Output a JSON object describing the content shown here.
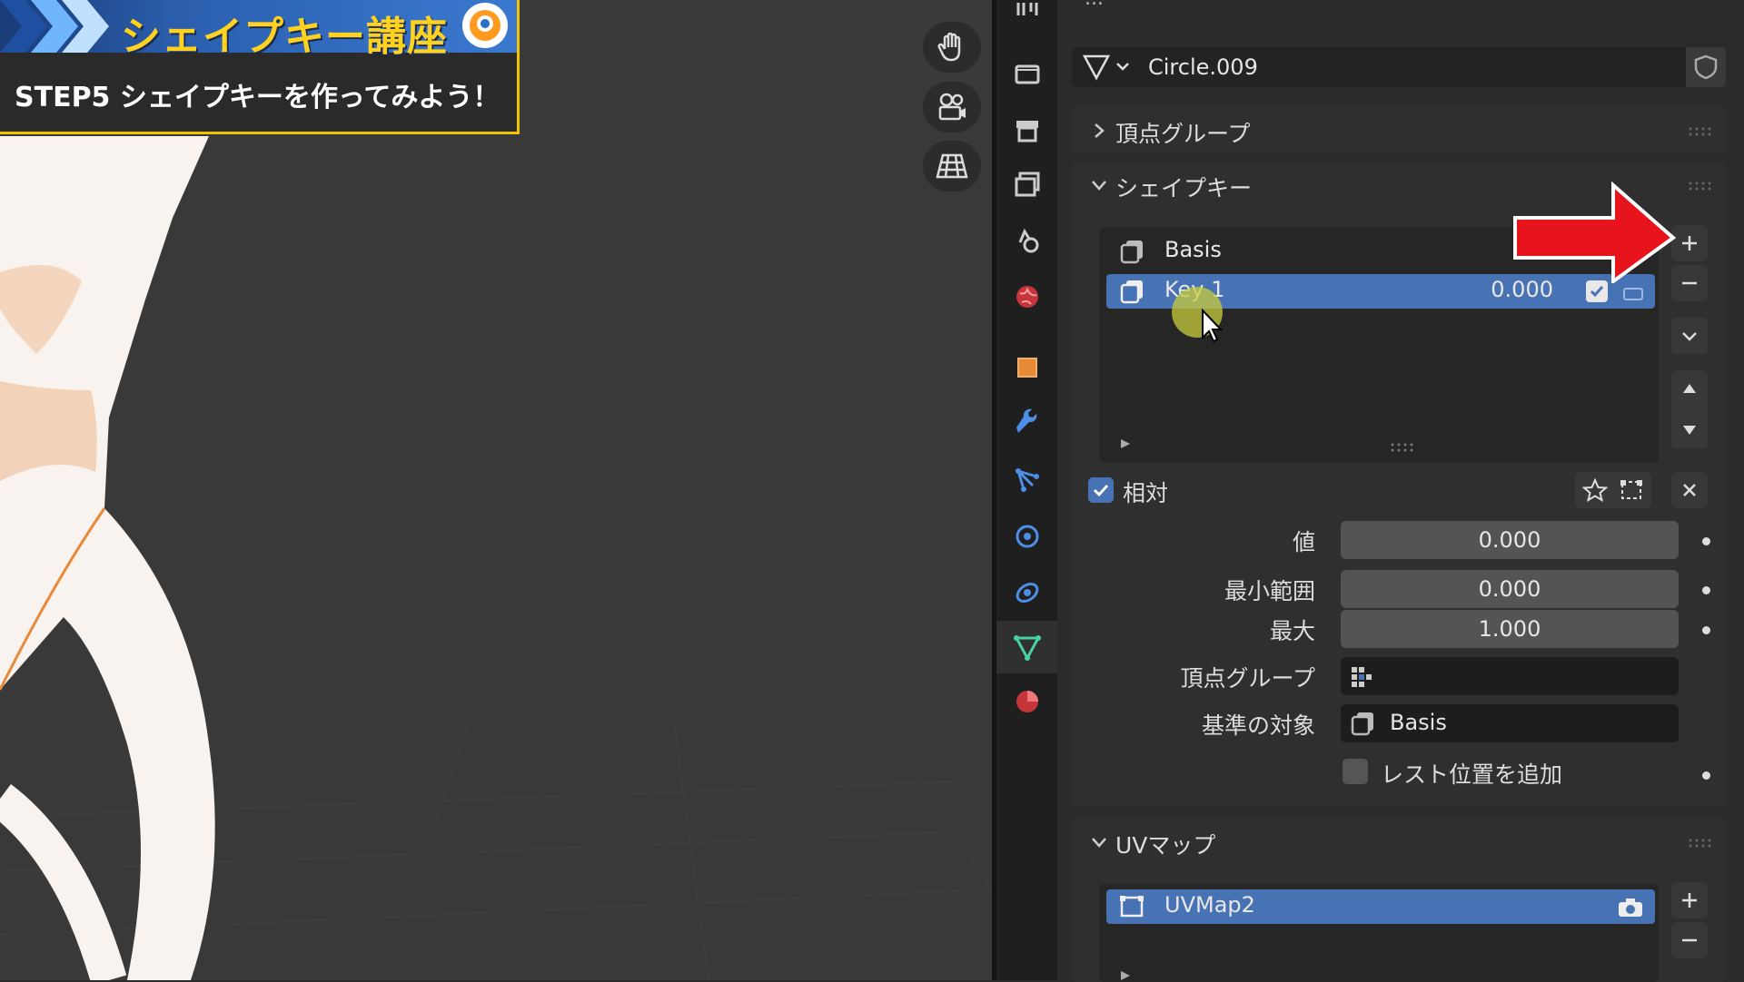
{
  "banner": {
    "title": "シェイプキー講座",
    "subtitle": "STEP5 シェイプキーを作ってみよう！"
  },
  "viewport_tools": [
    "hand-icon",
    "camera-icon",
    "grid-icon"
  ],
  "properties": {
    "breadcrumb": "...",
    "data_name": "Circle.009",
    "sections": {
      "vertex_groups": {
        "label": "頂点グループ",
        "expanded": false
      },
      "shape_keys": {
        "label": "シェイプキー",
        "expanded": true,
        "items": [
          {
            "name": "Basis",
            "selected": false
          },
          {
            "name": "Key 1",
            "value": "0.000",
            "selected": true,
            "enabled": true
          }
        ],
        "relative_label": "相対",
        "relative_checked": true,
        "fields": {
          "value_label": "値",
          "value": "0.000",
          "range_min_label": "最小範囲",
          "range_min": "0.000",
          "max_label": "最大",
          "max": "1.000",
          "vertex_group_label": "頂点グループ",
          "relative_to_label": "基準の対象",
          "relative_to": "Basis",
          "add_rest_label": "レスト位置を追加"
        }
      },
      "uv_maps": {
        "label": "UVマップ",
        "expanded": true,
        "items": [
          {
            "name": "UVMap2",
            "selected": true
          }
        ]
      }
    }
  },
  "colors": {
    "selection": "#4772b3",
    "banner_title": "#ffd21f",
    "banner_border": "#f2c400",
    "annotation_arrow": "#e8141b",
    "active_tab": "#48d1a6"
  }
}
